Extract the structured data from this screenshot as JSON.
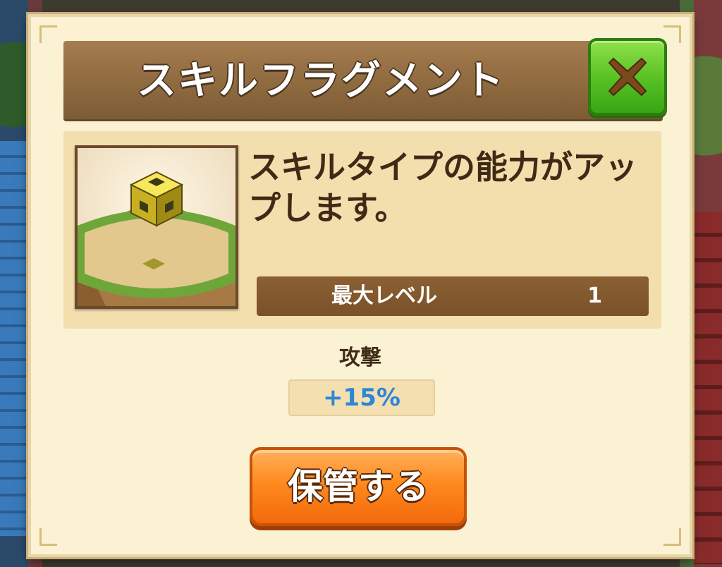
{
  "modal": {
    "title": "スキルフラグメント",
    "description": "スキルタイプの能力がアップします。",
    "max_level_label": "最大レベル",
    "max_level_value": "1",
    "stat_label": "攻撃",
    "stat_value": "+15%",
    "store_button": "保管する",
    "close_icon": "close-x-icon"
  },
  "colors": {
    "header": "#8e6a3f",
    "close_button": "#55c022",
    "store_button": "#ff8a1f",
    "stat_value": "#2e86d6"
  }
}
